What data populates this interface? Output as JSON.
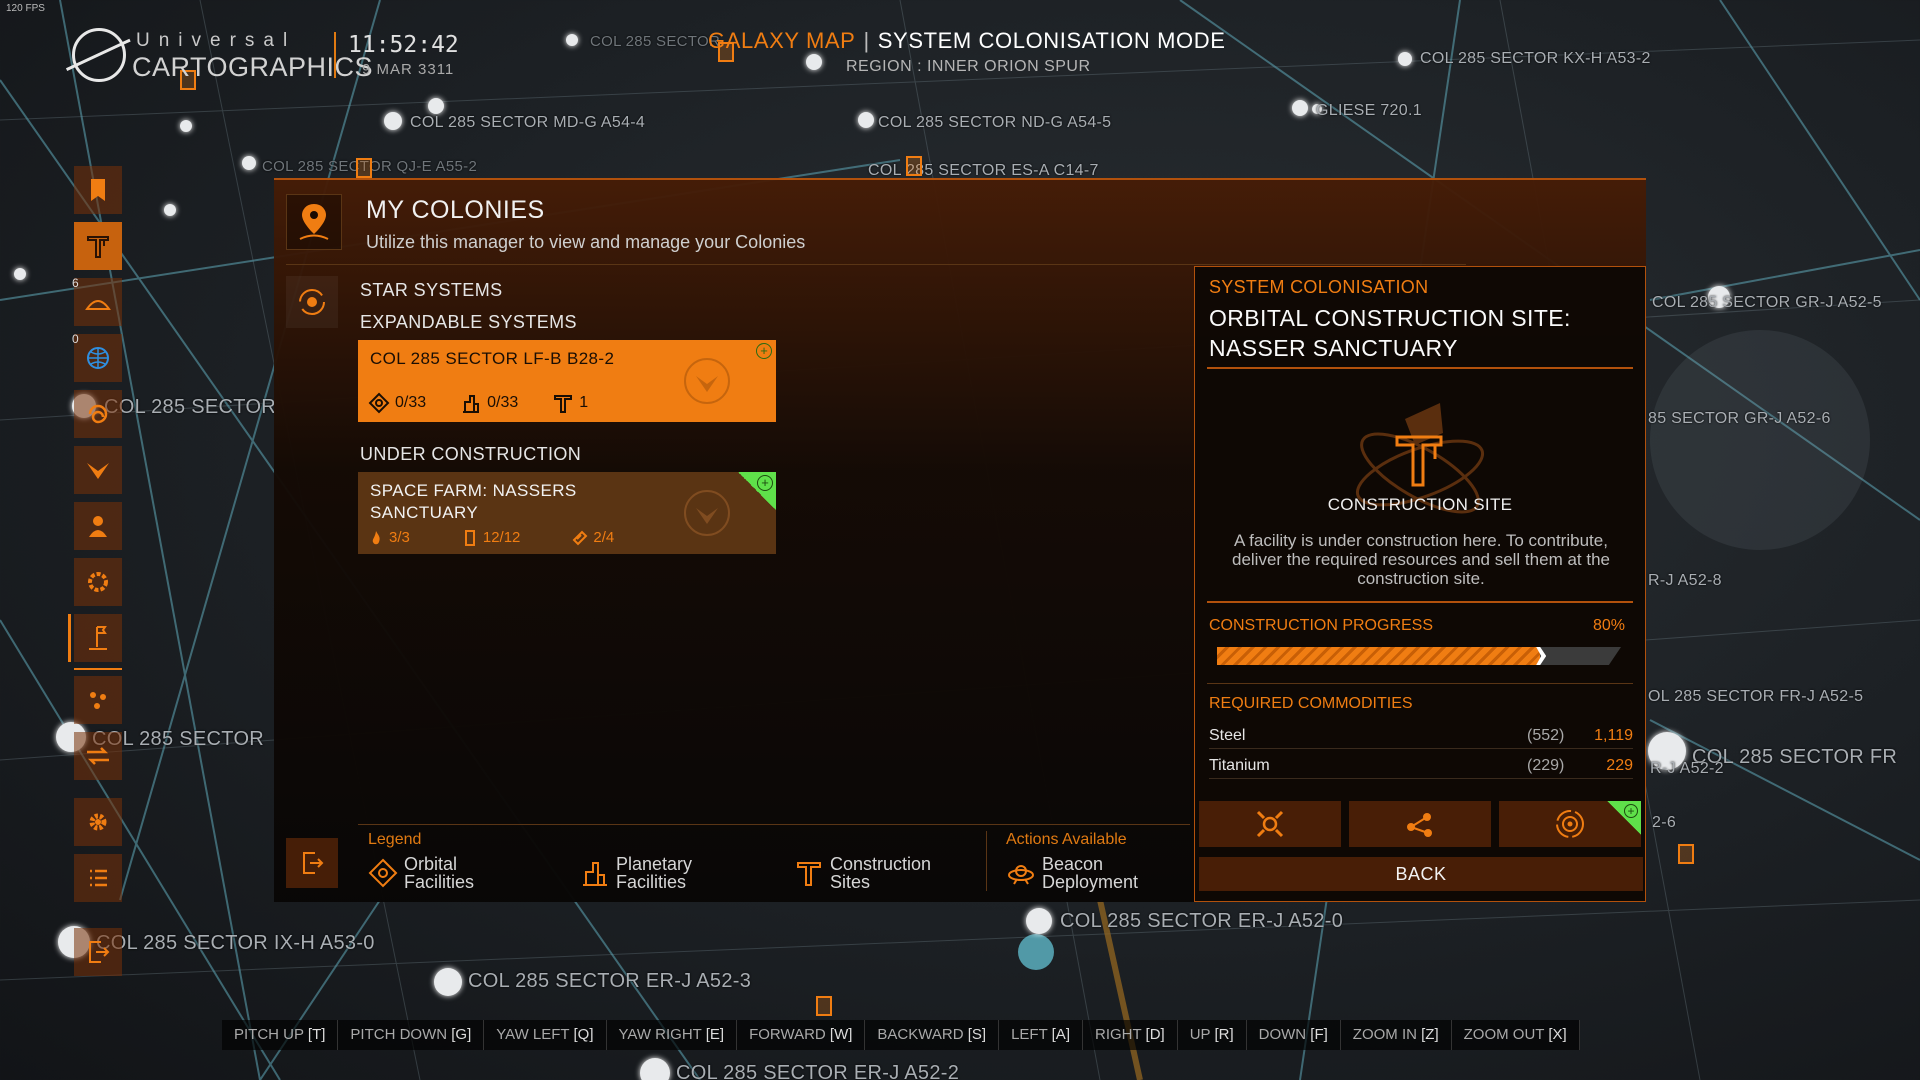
{
  "hud": {
    "fps": "120 FPS",
    "logo_top": "Universal",
    "logo_bottom": "CARTOGRAPHICS",
    "clock": "11:52:42",
    "date": "9 MAR 3311",
    "galaxy_map": "GALAXY MAP",
    "separator": "|",
    "mode": "SYSTEM COLONISATION MODE",
    "region": "REGION : INNER ORION SPUR"
  },
  "star_labels": [
    "COL 285 SECTOR KX-H A53-2",
    "COL 285 SECTOR",
    "COL 285 SECTOR MD-G A54-4",
    "COL 285 SECTOR ND-G A54-5",
    "GLIESE 720.1",
    "COL 285 SECTOR QJ-E A55-2",
    "COL 285 SECTOR ES-A C14-7",
    "COL 285 SECTOR",
    "COL 285 SECTOR",
    "COL 285 SECTOR IX-H A53-0",
    "COL 285 SECTOR ER-J A52-3",
    "COL 285 SECTOR ER-J A52-0",
    "COL 285 SECTOR ER-J A52-2",
    "COL 285 SECTOR GR-J A52-5",
    "85 SECTOR GR-J A52-6",
    "R-J A52-8",
    "OL 285 SECTOR FR-J A52-5",
    "COL 285 SECTOR FR",
    "R-J A52-2",
    "2-6"
  ],
  "sidebar": {
    "items": [
      {
        "icon": "bookmark-icon"
      },
      {
        "icon": "construction-crane-icon"
      },
      {
        "icon": "planet-icon",
        "count": "6"
      },
      {
        "icon": "globe-icon",
        "count": "0"
      },
      {
        "icon": "spiral-icon"
      },
      {
        "icon": "faction-wings-icon"
      },
      {
        "icon": "person-icon"
      },
      {
        "icon": "gear-icon"
      },
      {
        "icon": "colony-flag-icon"
      },
      {
        "icon": "cluster-icon"
      },
      {
        "icon": "route-arrows-icon"
      },
      {
        "icon": "settings-cog-icon"
      },
      {
        "icon": "list-icon"
      },
      {
        "icon": "exit-icon"
      }
    ]
  },
  "panel": {
    "title": "MY COLONIES",
    "subtitle": "Utilize this manager to view and manage your Colonies",
    "star_systems_label": "STAR SYSTEMS",
    "expandable_label": "EXPANDABLE SYSTEMS",
    "under_construction_label": "UNDER CONSTRUCTION",
    "expandable": {
      "name": "COL 285 SECTOR LF-B B28-2",
      "orbital": "0/33",
      "planetary": "0/33",
      "construction": "1"
    },
    "construction": {
      "name": "SPACE FARM: NASSERS SANCTUARY",
      "stat1": "3/3",
      "stat2": "12/12",
      "stat3": "2/4"
    },
    "legend": {
      "legend_label": "Legend",
      "orbital": "Orbital Facilities",
      "planetary": "Planetary Facilities",
      "construction": "Construction Sites",
      "actions_label": "Actions Available",
      "beacon": "Beacon Deployment"
    }
  },
  "detail": {
    "kicker": "SYSTEM COLONISATION",
    "title": "ORBITAL CONSTRUCTION SITE: NASSER SANCTUARY",
    "site_label": "CONSTRUCTION SITE",
    "description": "A facility is under construction here. To contribute, deliver the required resources and sell them at the construction site.",
    "progress_label": "CONSTRUCTION PROGRESS",
    "progress_text": "80%",
    "progress_value": 0.8,
    "required_label": "REQUIRED COMMODITIES",
    "commodities": [
      {
        "name": "Steel",
        "paren": "(552)",
        "need": "1,119"
      },
      {
        "name": "Titanium",
        "paren": "(229)",
        "need": "229"
      }
    ],
    "back_label": "BACK"
  },
  "keys": [
    {
      "label": "PITCH UP",
      "key": "[T]"
    },
    {
      "label": "PITCH DOWN",
      "key": "[G]"
    },
    {
      "label": "YAW LEFT",
      "key": "[Q]"
    },
    {
      "label": "YAW RIGHT",
      "key": "[E]"
    },
    {
      "label": "FORWARD",
      "key": "[W]"
    },
    {
      "label": "BACKWARD",
      "key": "[S]"
    },
    {
      "label": "LEFT",
      "key": "[A]"
    },
    {
      "label": "RIGHT",
      "key": "[D]"
    },
    {
      "label": "UP",
      "key": "[R]"
    },
    {
      "label": "DOWN",
      "key": "[F]"
    },
    {
      "label": "ZOOM IN",
      "key": "[Z]"
    },
    {
      "label": "ZOOM OUT",
      "key": "[X]"
    }
  ],
  "colors": {
    "accent": "#f07d12",
    "accent_dark": "#b2510c",
    "ready": "#5fe04a"
  }
}
